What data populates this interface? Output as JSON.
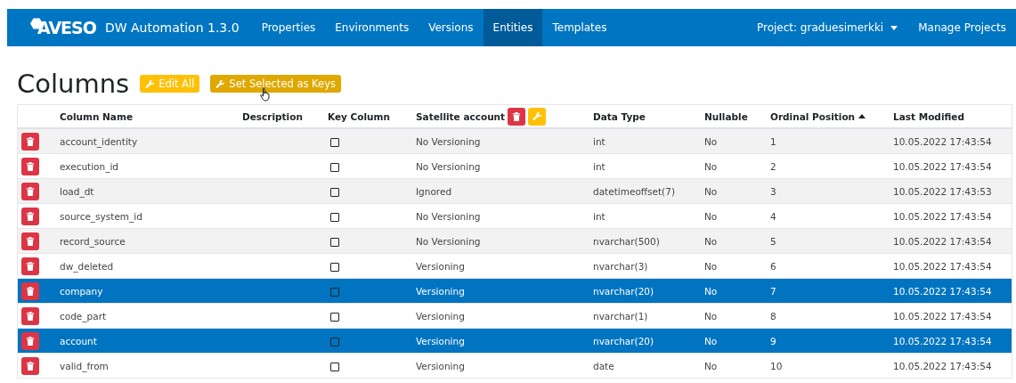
{
  "navbar": {
    "logo": "AVESO",
    "title": "DW Automation 1.3.0",
    "items": [
      {
        "label": "Properties",
        "selected": false
      },
      {
        "label": "Environments",
        "selected": false
      },
      {
        "label": "Versions",
        "selected": false
      },
      {
        "label": "Entities",
        "selected": true
      },
      {
        "label": "Templates",
        "selected": false
      }
    ],
    "project_menu": "Project: graduesimerkki",
    "manage_link": "Manage Projects"
  },
  "page": {
    "title": "Columns",
    "buttons": [
      {
        "label": "Edit All",
        "hovered": false
      },
      {
        "label": "Set Selected as Keys",
        "hovered": true
      }
    ]
  },
  "table": {
    "columns": [
      {
        "label": "Column Name",
        "sorted": false,
        "actions": false
      },
      {
        "label": "Description",
        "sorted": false,
        "actions": false
      },
      {
        "label": "Key Column",
        "sorted": false,
        "actions": false
      },
      {
        "label": "Satellite account",
        "sorted": false,
        "actions": true
      },
      {
        "label": "Data Type",
        "sorted": false,
        "actions": false
      },
      {
        "label": "Nullable",
        "sorted": false,
        "actions": false
      },
      {
        "label": "Ordinal Position",
        "sorted": true,
        "actions": false
      },
      {
        "label": "Last Modified",
        "sorted": false,
        "actions": false
      }
    ],
    "rows": [
      {
        "name": "account_identity",
        "key": false,
        "satellite": "No Versioning",
        "data_type": "int",
        "nullable": "No",
        "ordinal": "1",
        "modified": "10.05.2022 17:43:54",
        "selected": false
      },
      {
        "name": "execution_id",
        "key": false,
        "satellite": "No Versioning",
        "data_type": "int",
        "nullable": "No",
        "ordinal": "2",
        "modified": "10.05.2022 17:43:54",
        "selected": false
      },
      {
        "name": "load_dt",
        "key": false,
        "satellite": "Ignored",
        "data_type": "datetimeoffset(7)",
        "nullable": "No",
        "ordinal": "3",
        "modified": "10.05.2022 17:43:53",
        "selected": false
      },
      {
        "name": "source_system_id",
        "key": false,
        "satellite": "No Versioning",
        "data_type": "int",
        "nullable": "No",
        "ordinal": "4",
        "modified": "10.05.2022 17:43:54",
        "selected": false
      },
      {
        "name": "record_source",
        "key": false,
        "satellite": "No Versioning",
        "data_type": "nvarchar(500)",
        "nullable": "No",
        "ordinal": "5",
        "modified": "10.05.2022 17:43:54",
        "selected": false
      },
      {
        "name": "dw_deleted",
        "key": false,
        "satellite": "Versioning",
        "data_type": "nvarchar(3)",
        "nullable": "No",
        "ordinal": "6",
        "modified": "10.05.2022 17:43:54",
        "selected": false
      },
      {
        "name": "company",
        "key": false,
        "satellite": "Versioning",
        "data_type": "nvarchar(20)",
        "nullable": "No",
        "ordinal": "7",
        "modified": "10.05.2022 17:43:54",
        "selected": true
      },
      {
        "name": "code_part",
        "key": false,
        "satellite": "Versioning",
        "data_type": "nvarchar(1)",
        "nullable": "No",
        "ordinal": "8",
        "modified": "10.05.2022 17:43:54",
        "selected": false
      },
      {
        "name": "account",
        "key": false,
        "satellite": "Versioning",
        "data_type": "nvarchar(20)",
        "nullable": "No",
        "ordinal": "9",
        "modified": "10.05.2022 17:43:54",
        "selected": true
      },
      {
        "name": "valid_from",
        "key": false,
        "satellite": "Versioning",
        "data_type": "date",
        "nullable": "No",
        "ordinal": "10",
        "modified": "10.05.2022 17:43:54",
        "selected": false
      }
    ]
  }
}
